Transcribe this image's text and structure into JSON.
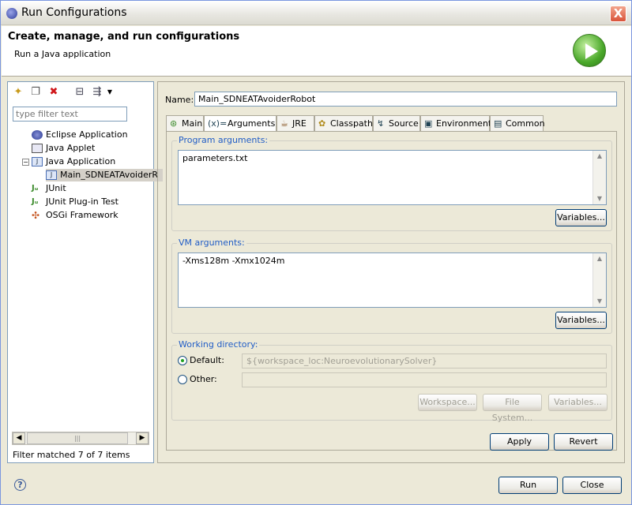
{
  "window": {
    "title": "Run Configurations",
    "close_glyph": "X"
  },
  "header": {
    "title": "Create, manage, and run configurations",
    "subtitle": "Run a Java application",
    "icon": "run-icon"
  },
  "left": {
    "filter_placeholder": "type filter text",
    "tree": [
      {
        "label": "Eclipse Application",
        "icon": "eclipse-icon",
        "level": 1
      },
      {
        "label": "Java Applet",
        "icon": "java-applet-icon",
        "level": 1
      },
      {
        "label": "Java Application",
        "icon": "java-app-icon",
        "level": 1
      },
      {
        "label": "Main_SDNEATAvoiderR",
        "icon": "java-config-icon",
        "level": 2
      },
      {
        "label": "JUnit",
        "icon": "junit-icon",
        "level": 1
      },
      {
        "label": "JUnit Plug-in Test",
        "icon": "junit-plugin-icon",
        "level": 1
      },
      {
        "label": "OSGi Framework",
        "icon": "osgi-icon",
        "level": 1
      }
    ],
    "scroll_grip": "|||",
    "status": "Filter matched 7 of 7 items"
  },
  "right": {
    "name_label": "Name:",
    "name_value": "Main_SDNEATAvoiderRobot",
    "tabs": [
      {
        "label": "Main",
        "icon": "⊛"
      },
      {
        "label": "Arguments",
        "icon": "(x)="
      },
      {
        "label": "JRE",
        "icon": "☕"
      },
      {
        "label": "Classpath",
        "icon": "✿"
      },
      {
        "label": "Source",
        "icon": "↯"
      },
      {
        "label": "Environment",
        "icon": "▣"
      },
      {
        "label": "Common",
        "icon": "▤"
      }
    ],
    "program_args": {
      "label": "Program arguments:",
      "value": "parameters.txt",
      "variables_button": "Variables..."
    },
    "vm_args": {
      "label": "VM arguments:",
      "value": "-Xms128m -Xmx1024m",
      "variables_button": "Variables..."
    },
    "working_dir": {
      "label": "Working directory:",
      "default_label": "Default:",
      "default_value": "${workspace_loc:NeuroevolutionarySolver}",
      "other_label": "Other:",
      "other_value": "",
      "workspace_button": "Workspace...",
      "filesystem_button": "File System...",
      "variables_button": "Variables..."
    },
    "apply_button": "Apply",
    "revert_button": "Revert"
  },
  "footer": {
    "help_glyph": "?",
    "run_button": "Run",
    "close_button": "Close"
  }
}
